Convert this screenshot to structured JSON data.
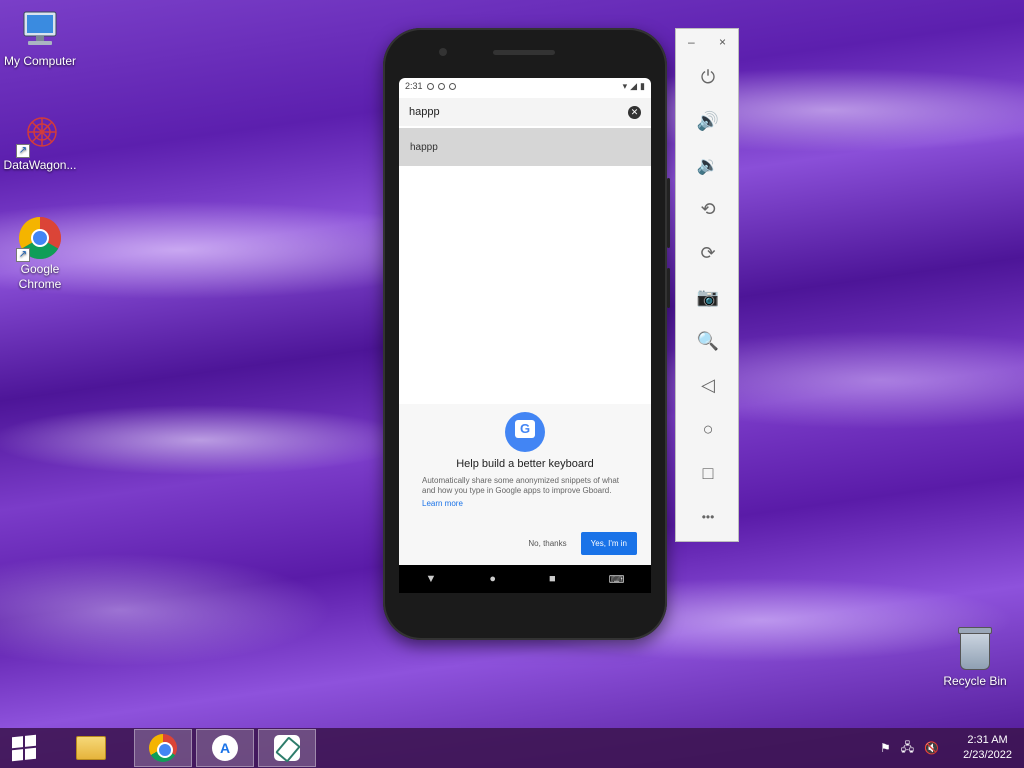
{
  "desktop": {
    "icons": [
      {
        "label": "My Computer",
        "icon": "computer-icon"
      },
      {
        "label": "DataWagon...",
        "icon": "datawagon-icon"
      },
      {
        "label": "Google Chrome",
        "icon": "chrome-icon"
      }
    ],
    "recycle_bin": {
      "label": "Recycle Bin",
      "icon": "recycle-bin-icon"
    }
  },
  "phone": {
    "status_time": "2:31",
    "search": {
      "query": "happp"
    },
    "suggestions": [
      "happp"
    ],
    "sheet": {
      "title": "Help build a better keyboard",
      "body": "Automatically share some anonymized snippets of what and how you type in Google apps to improve Gboard.",
      "link": "Learn more",
      "decline": "No, thanks",
      "accept": "Yes, I'm in"
    },
    "nav": {
      "back": "▼",
      "home": "●",
      "recents": "■",
      "keyboard": "⌨"
    }
  },
  "emulator_toolbar": {
    "minimize": "–",
    "close": "×",
    "buttons": [
      {
        "name": "power-icon",
        "glyph": "⏻"
      },
      {
        "name": "volume-up-icon",
        "glyph": "🔊"
      },
      {
        "name": "volume-down-icon",
        "glyph": "🔉"
      },
      {
        "name": "rotate-left-icon",
        "glyph": "⟲"
      },
      {
        "name": "rotate-right-icon",
        "glyph": "⟳"
      },
      {
        "name": "camera-icon",
        "glyph": "📷"
      },
      {
        "name": "zoom-icon",
        "glyph": "🔍"
      },
      {
        "name": "back-icon",
        "glyph": "◁"
      },
      {
        "name": "home-icon",
        "glyph": "○"
      },
      {
        "name": "overview-icon",
        "glyph": "□"
      },
      {
        "name": "more-icon",
        "glyph": "•••"
      }
    ]
  },
  "taskbar": {
    "clock_time": "2:31 AM",
    "clock_date": "2/23/2022",
    "tray": {
      "flag": "⚑",
      "network": "🖧",
      "volume": "🔇"
    }
  }
}
